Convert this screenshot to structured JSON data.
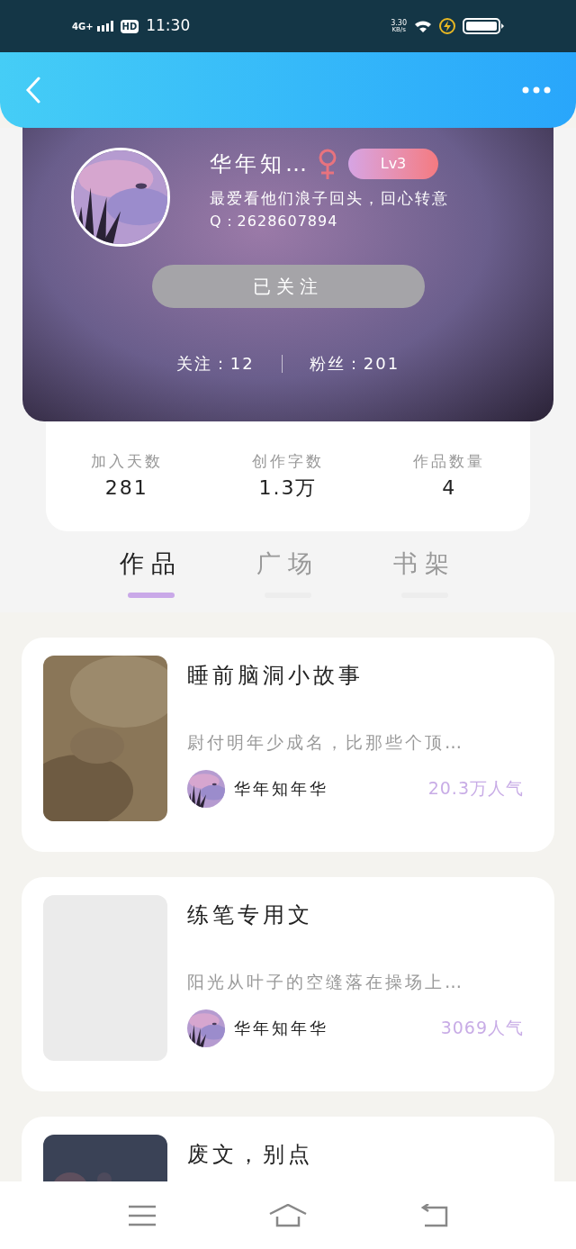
{
  "status_bar": {
    "network": "4G+",
    "hd": "HD",
    "time": "11:30",
    "speed": "3.30",
    "speed_unit": "KB/s"
  },
  "profile": {
    "name": "华年知…",
    "level": "Lv3",
    "bio": "最爱看他们浪子回头，回心转意",
    "qq": "Q：2628607894",
    "follow_button": "已关注",
    "following": "关注：12",
    "followers": "粉丝：201"
  },
  "stats": [
    {
      "label": "加入天数",
      "value": "281"
    },
    {
      "label": "创作字数",
      "value": "1.3万"
    },
    {
      "label": "作品数量",
      "value": "4"
    }
  ],
  "tabs": [
    {
      "label": "作品",
      "selected": true
    },
    {
      "label": "广场",
      "selected": false
    },
    {
      "label": "书架",
      "selected": false
    }
  ],
  "books": [
    {
      "title": "睡前脑洞小故事",
      "excerpt": "尉付明年少成名，比那些个顶…",
      "author": "华年知年华",
      "popularity": "20.3万人气"
    },
    {
      "title": "练笔专用文",
      "cover": {
        "kind": "empty"
      },
      "excerpt": "阳光从叶子的空缝落在操场上…",
      "author": "华年知年华",
      "popularity": "3069人气"
    },
    {
      "title": "废文，别点",
      "cover": {
        "kind": "dark"
      }
    }
  ]
}
